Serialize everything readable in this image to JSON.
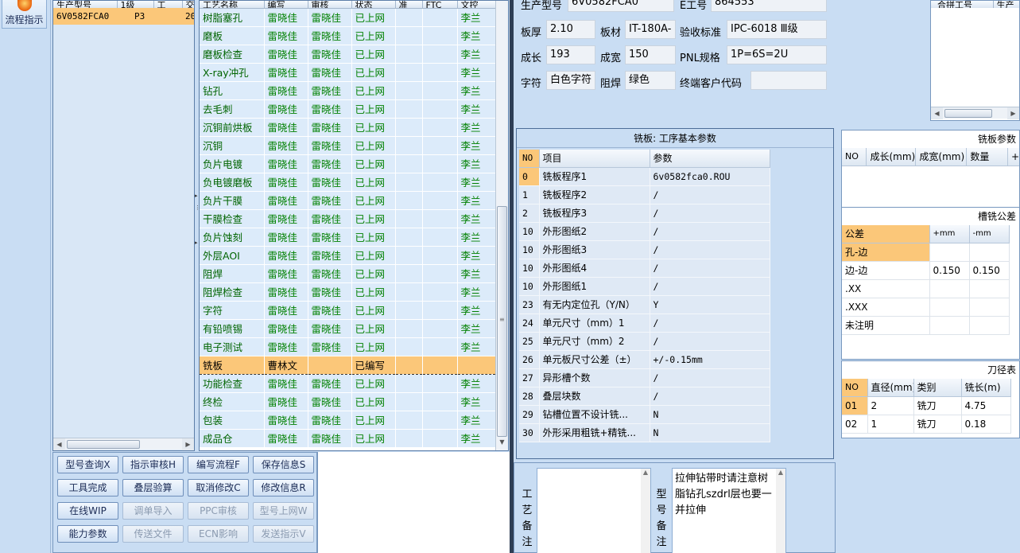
{
  "leftbar": {
    "flow_label": "流程指示"
  },
  "product_list": {
    "headers": [
      "生产型号",
      "1级",
      "工",
      "交"
    ],
    "rows": [
      {
        "model": "6V0582FCA0",
        "level": "P3",
        "extra": "20"
      }
    ]
  },
  "process_list": {
    "headers": [
      "工艺名称",
      "编写",
      "审核",
      "状态",
      "准",
      "FTC",
      "文控"
    ],
    "rows": [
      {
        "name": "树脂塞孔",
        "writer": "雷晓佳",
        "reviewer": "雷晓佳",
        "status": "已上网",
        "doc": "李兰"
      },
      {
        "name": "磨板",
        "writer": "雷晓佳",
        "reviewer": "雷晓佳",
        "status": "已上网",
        "doc": "李兰"
      },
      {
        "name": "磨板检查",
        "writer": "雷晓佳",
        "reviewer": "雷晓佳",
        "status": "已上网",
        "doc": "李兰"
      },
      {
        "name": "X-ray冲孔",
        "writer": "雷晓佳",
        "reviewer": "雷晓佳",
        "status": "已上网",
        "doc": "李兰"
      },
      {
        "name": "钻孔",
        "writer": "雷晓佳",
        "reviewer": "雷晓佳",
        "status": "已上网",
        "doc": "李兰"
      },
      {
        "name": "去毛刺",
        "writer": "雷晓佳",
        "reviewer": "雷晓佳",
        "status": "已上网",
        "doc": "李兰"
      },
      {
        "name": "沉铜前烘板",
        "writer": "雷晓佳",
        "reviewer": "雷晓佳",
        "status": "已上网",
        "doc": "李兰"
      },
      {
        "name": "沉铜",
        "writer": "雷晓佳",
        "reviewer": "雷晓佳",
        "status": "已上网",
        "doc": "李兰"
      },
      {
        "name": "负片电镀",
        "writer": "雷晓佳",
        "reviewer": "雷晓佳",
        "status": "已上网",
        "doc": "李兰"
      },
      {
        "name": "负电镀磨板",
        "writer": "雷晓佳",
        "reviewer": "雷晓佳",
        "status": "已上网",
        "doc": "李兰"
      },
      {
        "name": "负片干膜",
        "writer": "雷晓佳",
        "reviewer": "雷晓佳",
        "status": "已上网",
        "doc": "李兰"
      },
      {
        "name": "干膜检查",
        "writer": "雷晓佳",
        "reviewer": "雷晓佳",
        "status": "已上网",
        "doc": "李兰"
      },
      {
        "name": "负片蚀刻",
        "writer": "雷晓佳",
        "reviewer": "雷晓佳",
        "status": "已上网",
        "doc": "李兰"
      },
      {
        "name": "外层AOI",
        "writer": "雷晓佳",
        "reviewer": "雷晓佳",
        "status": "已上网",
        "doc": "李兰"
      },
      {
        "name": "阻焊",
        "writer": "雷晓佳",
        "reviewer": "雷晓佳",
        "status": "已上网",
        "doc": "李兰"
      },
      {
        "name": "阻焊检查",
        "writer": "雷晓佳",
        "reviewer": "雷晓佳",
        "status": "已上网",
        "doc": "李兰"
      },
      {
        "name": "字符",
        "writer": "雷晓佳",
        "reviewer": "雷晓佳",
        "status": "已上网",
        "doc": "李兰"
      },
      {
        "name": "有铅喷锡",
        "writer": "雷晓佳",
        "reviewer": "雷晓佳",
        "status": "已上网",
        "doc": "李兰"
      },
      {
        "name": "电子测试",
        "writer": "雷晓佳",
        "reviewer": "雷晓佳",
        "status": "已上网",
        "doc": "李兰"
      },
      {
        "name": "铣板",
        "writer": "曹林文",
        "reviewer": "",
        "status": "已编写",
        "doc": ""
      },
      {
        "name": "功能检查",
        "writer": "雷晓佳",
        "reviewer": "雷晓佳",
        "status": "已上网",
        "doc": "李兰"
      },
      {
        "name": "终检",
        "writer": "雷晓佳",
        "reviewer": "雷晓佳",
        "status": "已上网",
        "doc": "李兰"
      },
      {
        "name": "包装",
        "writer": "雷晓佳",
        "reviewer": "雷晓佳",
        "status": "已上网",
        "doc": "李兰"
      },
      {
        "name": "成品仓",
        "writer": "雷晓佳",
        "reviewer": "雷晓佳",
        "status": "已上网",
        "doc": "李兰"
      }
    ]
  },
  "buttons": [
    {
      "label": "型号查询X",
      "enabled": true
    },
    {
      "label": "指示审核H",
      "enabled": true
    },
    {
      "label": "编写流程F",
      "enabled": true
    },
    {
      "label": "保存信息S",
      "enabled": true
    },
    {
      "label": "工具完成",
      "enabled": true
    },
    {
      "label": "叠层验算",
      "enabled": true
    },
    {
      "label": "取消修改C",
      "enabled": true
    },
    {
      "label": "修改信息R",
      "enabled": true
    },
    {
      "label": "在线WIP",
      "enabled": true
    },
    {
      "label": "调单导入",
      "enabled": false
    },
    {
      "label": "PPC审核",
      "enabled": false
    },
    {
      "label": "型号上网W",
      "enabled": false
    },
    {
      "label": "能力参数",
      "enabled": true
    },
    {
      "label": "传送文件",
      "enabled": false
    },
    {
      "label": "ECN影响",
      "enabled": false
    },
    {
      "label": "发送指示V",
      "enabled": false
    }
  ],
  "header": {
    "model_label": "生产型号",
    "model_value": "6V0582FCA0",
    "eno_label": "E工号",
    "eno_value": "864553",
    "thickness_label": "板厚",
    "thickness_value": "2.10",
    "material_label": "板材",
    "material_value": "IT-180A-",
    "standard_label": "验收标准",
    "standard_value": "IPC-6018 Ⅲ级",
    "length_label": "成长",
    "length_value": "193",
    "width_label": "成宽",
    "width_value": "150",
    "pnl_label": "PNL规格",
    "pnl_value": "1P=6S=2U",
    "char_label": "字符",
    "char_value": "白色字符",
    "mask_label": "阻焊",
    "mask_value": "绿色",
    "customer_label": "终端客户代码",
    "customer_value": ""
  },
  "rtop": {
    "headers": [
      "合拼工号",
      "生产"
    ]
  },
  "milling": {
    "title": "铣板: 工序基本参数",
    "headers": [
      "NO",
      "项目",
      "参数"
    ],
    "rows": [
      {
        "no": "0",
        "item": "铣板程序1",
        "value": "6v0582fca0.ROU"
      },
      {
        "no": "1",
        "item": "铣板程序2",
        "value": "/"
      },
      {
        "no": "2",
        "item": "铣板程序3",
        "value": "/"
      },
      {
        "no": "10",
        "item": "外形图纸2",
        "value": "/"
      },
      {
        "no": "10",
        "item": "外形图纸3",
        "value": "/"
      },
      {
        "no": "10",
        "item": "外形图纸4",
        "value": "/"
      },
      {
        "no": "10",
        "item": "外形图纸1",
        "value": "/"
      },
      {
        "no": "23",
        "item": "有无内定位孔（Y/N）",
        "value": "Y"
      },
      {
        "no": "24",
        "item": "单元尺寸（mm）1",
        "value": "/"
      },
      {
        "no": "25",
        "item": "单元尺寸（mm）2",
        "value": "/"
      },
      {
        "no": "26",
        "item": "单元板尺寸公差（±）",
        "value": "+/-0.15mm"
      },
      {
        "no": "27",
        "item": "异形槽个数",
        "value": "/"
      },
      {
        "no": "28",
        "item": "叠层块数",
        "value": "/"
      },
      {
        "no": "29",
        "item": "钻槽位置不设计铣...",
        "value": "N"
      },
      {
        "no": "30",
        "item": "外形采用粗铣+精铣...",
        "value": "N"
      }
    ]
  },
  "board_params": {
    "title": "铣板参数",
    "headers": [
      "NO",
      "成长(mm)",
      "成宽(mm)",
      "数量",
      "+"
    ]
  },
  "slot_tol": {
    "title": "槽铣公差",
    "headers": [
      "公差",
      "+mm",
      "-mm"
    ],
    "rows": [
      {
        "name": "孔-边",
        "plus": "",
        "minus": ""
      },
      {
        "name": "边-边",
        "plus": "0.150",
        "minus": "0.150"
      },
      {
        "name": ".XX",
        "plus": "",
        "minus": ""
      },
      {
        "name": ".XXX",
        "plus": "",
        "minus": ""
      },
      {
        "name": "未注明",
        "plus": "",
        "minus": ""
      }
    ]
  },
  "tool_dia": {
    "title": "刀径表",
    "headers": [
      "NO",
      "直径(mm)",
      "类别",
      "铣长(m)"
    ],
    "rows": [
      {
        "no": "01",
        "dia": "2",
        "type": "铣刀",
        "len": "4.75"
      },
      {
        "no": "02",
        "dia": "1",
        "type": "铣刀",
        "len": "0.18"
      }
    ]
  },
  "remarks": {
    "process_label": "工艺备注",
    "process_text": "",
    "model_label": "型号备注",
    "model_text": "拉伸钻带时请注意树脂钻孔szdrl层也要一并拉伸"
  }
}
